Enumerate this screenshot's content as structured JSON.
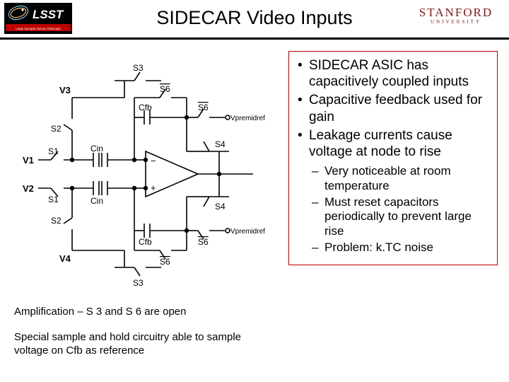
{
  "header": {
    "title": "SIDECAR Video Inputs",
    "lsst_top": "LSST",
    "lsst_bottom": "Large Synoptic Survey Telescope",
    "stanford_name": "STANFORD",
    "stanford_sub": "UNIVERSITY"
  },
  "diagram": {
    "labels": {
      "V1": "V1",
      "V2": "V2",
      "V3": "V3",
      "V4": "V4",
      "S1a": "S1",
      "S1b": "S1",
      "S2a": "S2",
      "S2b": "S2",
      "S3a": "S3",
      "S3b": "S3",
      "S4a": "S4",
      "S4b": "S4",
      "S6a": "S6",
      "S6b": "S6",
      "S6c": "S6",
      "S6d": "S6",
      "Cin_a": "Cin",
      "Cin_b": "Cin",
      "Cfb_a": "Cfb",
      "Cfb_b": "Cfb",
      "vpre_a": "Vpremidref",
      "vpre_b": "Vpremidref"
    }
  },
  "captions": {
    "amp": "Amplification – S 3 and S 6 are open",
    "sample": "Special sample and hold circuitry able to sample voltage on Cfb as reference"
  },
  "bullets": {
    "main": [
      "SIDECAR ASIC has capacitively coupled inputs",
      "Capacitive feedback used for gain",
      "Leakage currents cause voltage at node to rise"
    ],
    "sub": [
      "Very noticeable at room temperature",
      "Must reset capacitors periodically to prevent large rise",
      "Problem: k.TC noise"
    ]
  }
}
